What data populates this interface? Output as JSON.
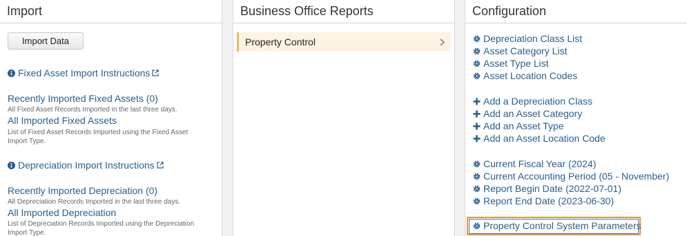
{
  "import_panel": {
    "title": "Import",
    "import_button": "Import Data",
    "fixed_asset_instructions": "Fixed Asset Import Instructions",
    "recent_fixed_assets": "Recently Imported Fixed Assets  (0)",
    "recent_fixed_assets_desc": "All Fixed Asset Records Imported in the last three days.",
    "all_fixed_assets": "All Imported Fixed Assets",
    "all_fixed_assets_desc_1": "List of Fixed Asset Records Imported using the Fixed Asset",
    "all_fixed_assets_desc_2": "Import Type.",
    "depreciation_instructions": "Depreciation Import Instructions",
    "recent_depreciation": "Recently Imported Depreciation  (0)",
    "recent_depreciation_desc": "All Depreciation Records Imported in the last three days.",
    "all_depreciation": "All Imported Depreciation",
    "all_depreciation_desc_1": "List of Depreciation Records Imported using the Depreciation",
    "all_depreciation_desc_2": "Import Type."
  },
  "reports_panel": {
    "title": "Business Office Reports",
    "items": [
      {
        "label": "Property Control"
      }
    ]
  },
  "config_panel": {
    "title": "Configuration",
    "lists": [
      "Depreciation Class List",
      "Asset Category List",
      "Asset Type List",
      "Asset Location Codes"
    ],
    "adds": [
      "Add a Depreciation Class",
      "Add an Asset Category",
      "Add an Asset Type",
      "Add an Asset Location Code"
    ],
    "settings": [
      "Current Fiscal Year (2024)",
      "Current Accounting Period (05 - November)",
      "Report Begin Date (2022-07-01)",
      "Report End Date (2023-06-30)"
    ],
    "system_parameters": "Property Control System Parameters"
  },
  "colors": {
    "link": "#2a5d8c",
    "highlight_border": "#f0952d",
    "selected_row_bg": "#fdf3e1",
    "selected_row_accent": "#f0b860"
  },
  "icons": {
    "info": "info-circle-icon",
    "external": "external-link-icon",
    "gear": "gear-icon",
    "plus": "plus-icon",
    "chevron": "chevron-right-icon"
  }
}
